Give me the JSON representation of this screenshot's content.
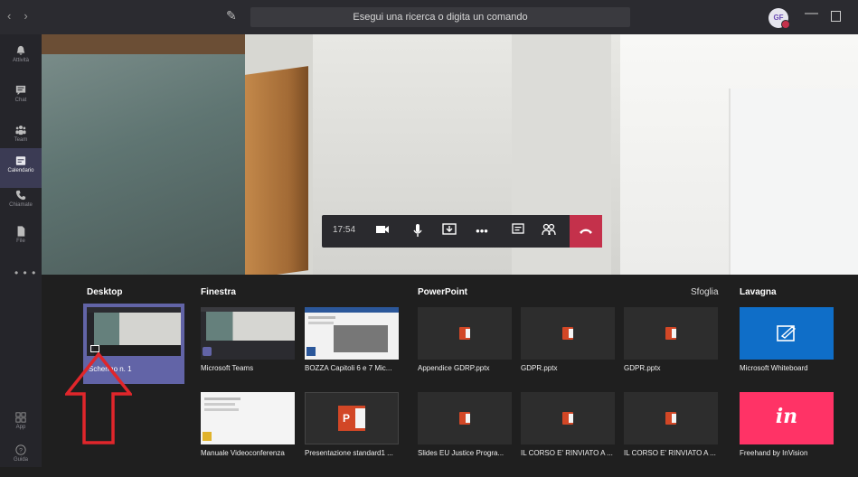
{
  "titlebar": {
    "search_placeholder": "Esegui una ricerca o digita un comando",
    "avatar_initials": "GF"
  },
  "rail": {
    "items": [
      {
        "label": "Attività",
        "icon": "bell-icon"
      },
      {
        "label": "Chat",
        "icon": "chat-icon"
      },
      {
        "label": "Team",
        "icon": "team-icon"
      },
      {
        "label": "Calendario",
        "icon": "calendar-icon"
      },
      {
        "label": "Chiamate",
        "icon": "phone-icon"
      },
      {
        "label": "File",
        "icon": "file-icon"
      }
    ],
    "more": "• • •",
    "bottom": [
      {
        "label": "App",
        "icon": "apps-icon"
      },
      {
        "label": "Guida",
        "icon": "help-icon"
      }
    ]
  },
  "callbar": {
    "time": "17:54"
  },
  "share": {
    "desktop": {
      "title": "Desktop",
      "items": [
        "Schermo n. 1"
      ]
    },
    "window": {
      "title": "Finestra",
      "items": [
        "Microsoft Teams",
        "BOZZA Capitoli 6 e 7 Mic...",
        "Manuale Videoconferenza",
        "Presentazione standard1 ..."
      ]
    },
    "powerpoint": {
      "title": "PowerPoint",
      "browse": "Sfoglia",
      "items": [
        "Appendice GDRP.pptx",
        "GDPR.pptx",
        "GDPR.pptx",
        "Slides EU Justice Progra...",
        "IL CORSO E' RINVIATO A ...",
        "IL CORSO E' RINVIATO A ..."
      ]
    },
    "whiteboard": {
      "title": "Lavagna",
      "items": [
        "Microsoft Whiteboard",
        "Freehand by InVision"
      ],
      "invision_logo": "in"
    }
  },
  "colors": {
    "accent": "#6264a7",
    "hangup": "#c4314b",
    "whiteboard": "#0f6ec8",
    "invision": "#ff3366"
  }
}
